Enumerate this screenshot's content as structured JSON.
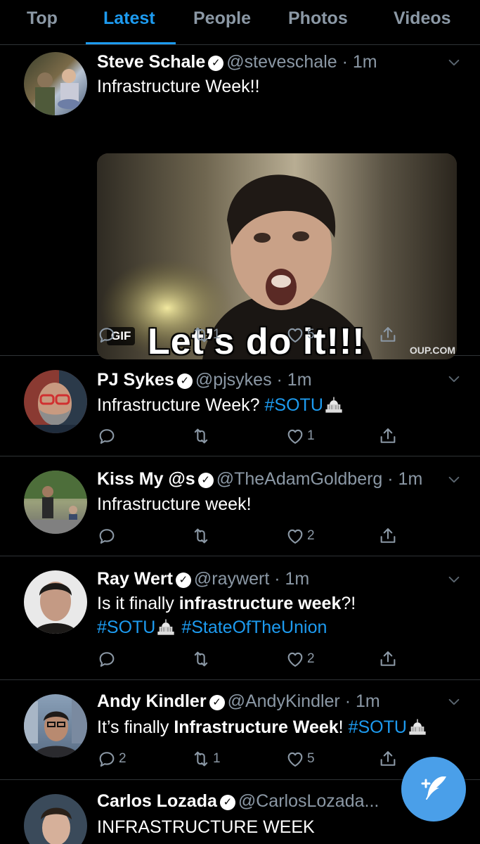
{
  "tabs": [
    {
      "label": "Top",
      "active": false
    },
    {
      "label": "Latest",
      "active": true
    },
    {
      "label": "People",
      "active": false
    },
    {
      "label": "Photos",
      "active": false
    },
    {
      "label": "Videos",
      "active": false
    }
  ],
  "colors": {
    "accent": "#1d9bf0",
    "muted": "#8b98a5",
    "divider": "#2f3336",
    "fab": "#4a9fe9"
  },
  "tweets": [
    {
      "name": "Steve Schale",
      "handle": "@steveschale",
      "time": "· 1m",
      "text": "Infrastructure Week!!",
      "media": {
        "badge": "GIF",
        "caption": "Let’s do it!!!",
        "watermark": "OUP.COM"
      },
      "replies": "",
      "retweets": "1",
      "likes": "5"
    },
    {
      "name": "PJ Sykes",
      "handle": "@pjsykes",
      "time": "· 1m",
      "text_before": "Infrastructure Week? ",
      "hashtag1": "#SOTU",
      "replies": "",
      "retweets": "",
      "likes": "1"
    },
    {
      "name": "Kiss My @s",
      "handle": "@TheAdamGoldberg",
      "time": "· 1m",
      "text": "Infrastructure week!",
      "replies": "",
      "retweets": "",
      "likes": "2"
    },
    {
      "name": "Ray Wert",
      "handle": "@raywert",
      "time": "· 1m",
      "text_before": "Is it finally ",
      "text_bold": "infrastructure week",
      "text_after": "?!",
      "hashtag1": "#SOTU",
      "hashtag2": "#StateOfTheUnion",
      "replies": "",
      "retweets": "",
      "likes": "2"
    },
    {
      "name": "Andy Kindler",
      "handle": "@AndyKindler",
      "time": "· 1m",
      "text_before": "It’s finally ",
      "text_bold": "Infrastructure Week",
      "text_after": "! ",
      "hashtag1": "#SOTU",
      "replies": "2",
      "retweets": "1",
      "likes": "5"
    },
    {
      "name": "Carlos Lozada",
      "handle": "@CarlosLozada...",
      "time": "",
      "text": "INFRASTRUCTURE WEEK"
    }
  ],
  "icons": {
    "reply": "reply-icon",
    "retweet": "retweet-icon",
    "like": "heart-icon",
    "share": "share-icon",
    "verified": "verified-icon",
    "chevron": "chevron-down-icon",
    "compose": "compose-tweet-icon",
    "capitol": "capitol-emoji-icon"
  }
}
